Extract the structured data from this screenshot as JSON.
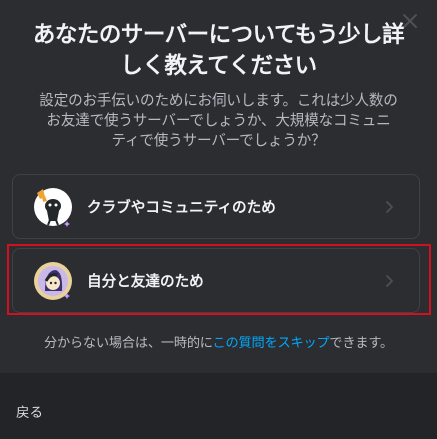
{
  "dialog": {
    "title_line1": "あなたのサーバーについてもう少し詳",
    "title_line2": "しく教えてください",
    "subtitle_line1": "設定のお手伝いのためにお伺いします。これは少人数の",
    "subtitle_line2": "お友達で使うサーバーでしょうか、大規模なコミュニ",
    "subtitle_line3": "ティで使うサーバーでしょうか？",
    "close_icon": "close-icon"
  },
  "options": [
    {
      "label": "クラブやコミュニティのため",
      "icon": "club-community-icon"
    },
    {
      "label": "自分と友達のため",
      "icon": "friends-icon"
    }
  ],
  "skip": {
    "prefix": "分からない場合は、一時的に",
    "link": "この質問をスキップ",
    "suffix": "できます。"
  },
  "footer": {
    "back_label": "戻る"
  },
  "colors": {
    "background": "#2b2d31",
    "footer": "#232428",
    "link": "#00a8fc",
    "highlight": "#d1111f"
  }
}
